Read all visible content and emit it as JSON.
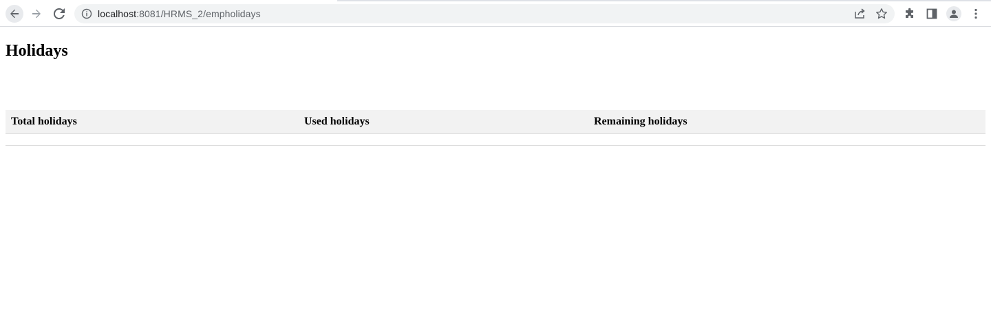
{
  "browser": {
    "url_host": "localhost",
    "url_path": ":8081/HRMS_2/empholidays",
    "icons": [
      "back-arrow-icon",
      "forward-arrow-icon",
      "reload-icon",
      "info-icon",
      "share-icon",
      "star-icon",
      "puzzle-icon",
      "side-panel-icon",
      "profile-icon",
      "kebab-menu-icon"
    ]
  },
  "page": {
    "title": "Holidays"
  },
  "table": {
    "headers": [
      "Total holidays",
      "Used holidays",
      "Remaining holidays"
    ],
    "rows": [
      [
        "",
        "",
        ""
      ]
    ]
  },
  "colors": {
    "header_row_bg": "#f2f2f2",
    "row_border": "#dddddd",
    "omnibox_bg": "#f1f3f4"
  }
}
